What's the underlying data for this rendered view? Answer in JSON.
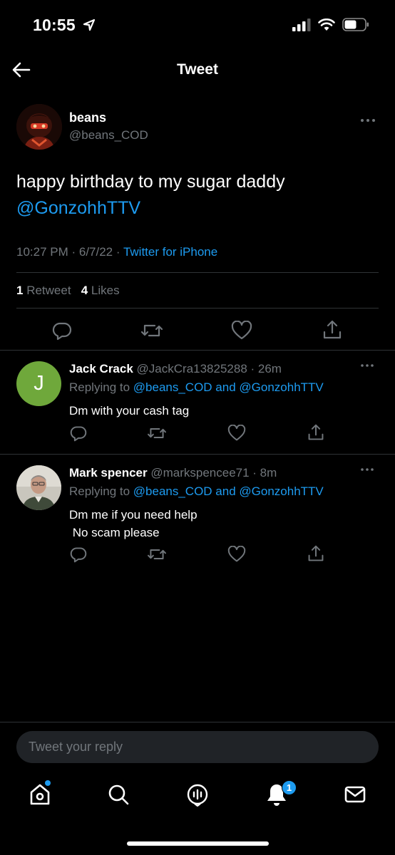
{
  "status_bar": {
    "time": "10:55"
  },
  "header": {
    "title": "Tweet"
  },
  "main_tweet": {
    "name": "beans",
    "handle": "@beans_COD",
    "text": "happy birthday to my sugar daddy",
    "mention": "@GonzohhTTV",
    "timestamp": "10:27 PM · 6/7/22 · ",
    "source": "Twitter for iPhone",
    "retweet_count": "1",
    "retweet_label": " Retweet",
    "like_count": "4",
    "like_label": " Likes"
  },
  "replies": [
    {
      "avatar_letter": "J",
      "name": "Jack Crack",
      "handle_time": " @JackCra13825288 · 26m",
      "replying_prefix": "Replying to ",
      "replying_mentions": "@beans_COD and @GonzohhTTV",
      "text": "Dm with your cash tag"
    },
    {
      "name": "Mark spencer",
      "handle_time": " @markspencee71 · 8m",
      "replying_prefix": "Replying to ",
      "replying_mentions": "@beans_COD and @GonzohhTTV",
      "text": "Dm me if you need help\n No scam please"
    }
  ],
  "reply_box": {
    "placeholder": "Tweet your reply"
  },
  "bottom_nav": {
    "items": [
      "home-icon",
      "search-icon",
      "spaces-icon",
      "notifications-icon",
      "messages-icon"
    ],
    "notification_badge": "1"
  },
  "colors": {
    "accent": "#1d9bf0",
    "background": "#000000",
    "muted": "#71767b",
    "divider": "#2f3336"
  }
}
